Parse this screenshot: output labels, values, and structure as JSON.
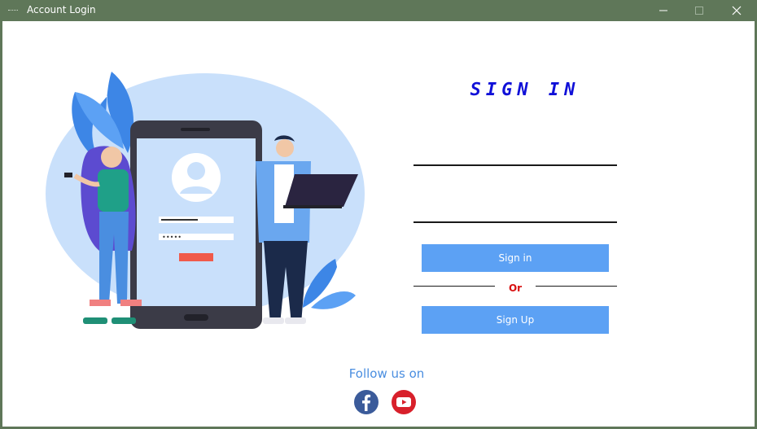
{
  "window": {
    "title": "Account Login",
    "icons": [
      "app-icon",
      "minimize-icon",
      "maximize-icon",
      "close-icon"
    ]
  },
  "form": {
    "heading": "SIGN IN",
    "username_value": "",
    "password_value": "",
    "signin_label": "Sign in",
    "or_label": "Or",
    "signup_label": "Sign Up"
  },
  "social": {
    "follow_label": "Follow us on",
    "icons": [
      "facebook-icon",
      "youtube-icon"
    ]
  },
  "colors": {
    "titlebar": "#5f7759",
    "button": "#5ca1f4",
    "heading": "#1010d8",
    "or": "#d81010",
    "follow": "#4a8ee0"
  }
}
